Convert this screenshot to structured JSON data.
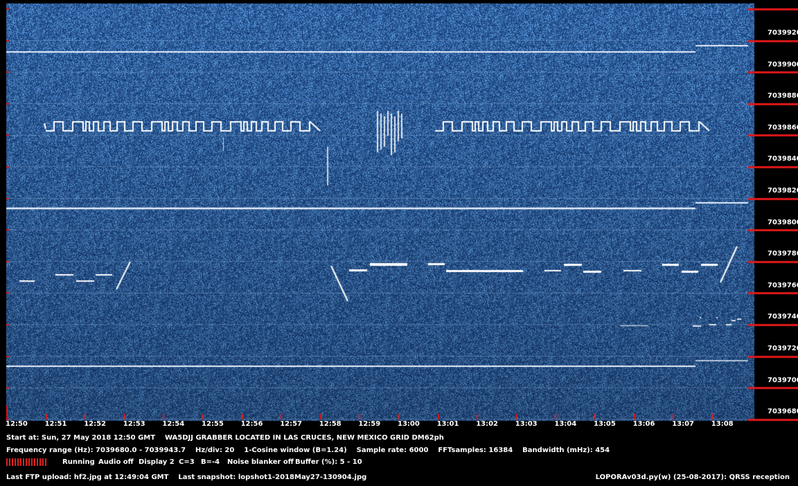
{
  "colors": {
    "background": "#000000",
    "waterfall_base": "#1c4f8f",
    "trace": "#ffffff",
    "tick_marks": "#e01818"
  },
  "freq_labels": [
    "7039920",
    "7039900",
    "7039880",
    "7039860",
    "7039840",
    "7039820",
    "7039800",
    "7039780",
    "7039760",
    "7039740",
    "7039720",
    "7039700",
    "7039680"
  ],
  "time_labels": [
    "12:50",
    "12:51",
    "12:52",
    "12:53",
    "12:54",
    "12:55",
    "12:56",
    "12:57",
    "12:58",
    "12:59",
    "13:00",
    "13:01",
    "13:02",
    "13:03",
    "13:04",
    "13:05",
    "13:06",
    "13:07",
    "13:08"
  ],
  "info": {
    "line1": "Start at: Sun, 27 May 2018 12:50 GMT    WA5DJJ GRABBER LOCATED IN LAS CRUCES, NEW MEXICO GRID DM62ph",
    "line2": "Frequency range (Hz): 7039680.0 - 7039943.7    Hz/div: 20    1-Cosine window (B=1.24)    Sample rate: 6000    FFTsamples: 16384    Bandwidth (mHz): 454",
    "last_ftp": "Last FTP upload: hf2.jpg at 12:49:04 GMT    Last snapshot: lopshot1-2018May27-130904.jpg",
    "version": "LOPORAv03d.py(w) (25-08-2017): QRSS reception"
  },
  "status": {
    "running": "Running",
    "audio": "Audio off",
    "display": "Display 2",
    "c": "C=3",
    "b": "B=-4",
    "noise_blanker": "Noise blanker off",
    "buffer": "Buffer (%): 5 - 10"
  }
}
